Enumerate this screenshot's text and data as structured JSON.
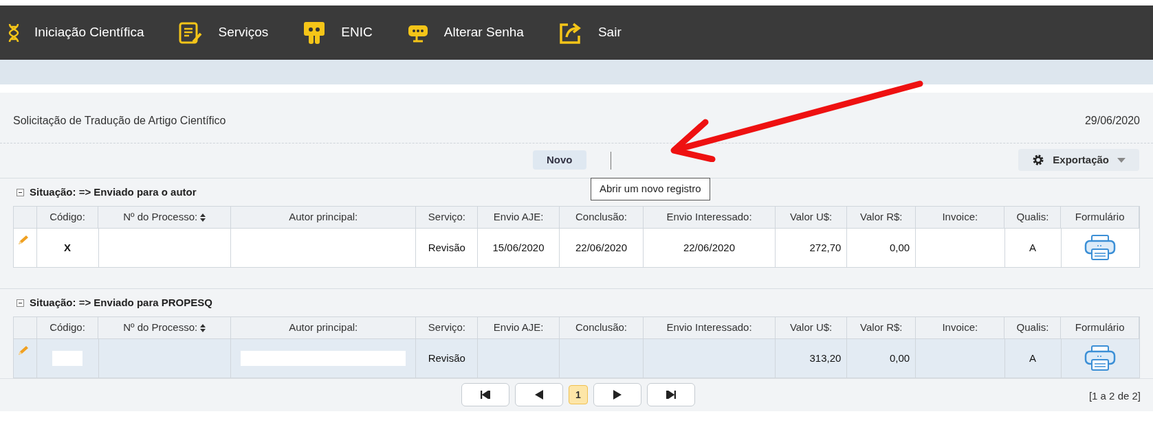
{
  "nav": [
    {
      "kind": "dna",
      "label": "Iniciação Científica"
    },
    {
      "kind": "form",
      "label": "Serviços"
    },
    {
      "kind": "badge",
      "label": "ENIC"
    },
    {
      "kind": "chat",
      "label": "Alterar Senha"
    },
    {
      "kind": "exit",
      "label": "Sair"
    }
  ],
  "page": {
    "title": "Solicitação de Tradução de Artigo Científico",
    "date": "29/06/2020"
  },
  "toolbar": {
    "new_button": "Novo",
    "tooltip": "Abrir um novo registro",
    "export_button": "Exportação"
  },
  "groups": [
    {
      "title": "Situação: => Enviado para o autor",
      "expanded": true,
      "selected": false,
      "columns": [
        "Código:",
        "Nº do Processo:",
        "Autor principal:",
        "Serviço:",
        "Envio AJE:",
        "Conclusão:",
        "Envio Interessado:",
        "Valor U$:",
        "Valor R$:",
        "Invoice:",
        "Qualis:",
        "Formulário"
      ],
      "rows": [
        {
          "codigo": "X",
          "processo": "",
          "autor": "",
          "servico": "Revisão",
          "envio_aje": "15/06/2020",
          "conclusao": "22/06/2020",
          "envio_interessado": "22/06/2020",
          "valor_usd": "272,70",
          "valor_brl": "0,00",
          "invoice": "",
          "qualis": "A",
          "redacted": false
        }
      ]
    },
    {
      "title": "Situação: => Enviado para PROPESQ",
      "expanded": true,
      "selected": true,
      "columns": [
        "Código:",
        "Nº do Processo:",
        "Autor principal:",
        "Serviço:",
        "Envio AJE:",
        "Conclusão:",
        "Envio Interessado:",
        "Valor U$:",
        "Valor R$:",
        "Invoice:",
        "Qualis:",
        "Formulário"
      ],
      "rows": [
        {
          "codigo": "",
          "processo": "",
          "autor": "",
          "servico": "Revisão",
          "envio_aje": "",
          "conclusao": "",
          "envio_interessado": "",
          "valor_usd": "313,20",
          "valor_brl": "0,00",
          "invoice": "",
          "qualis": "A",
          "redacted": true
        }
      ]
    }
  ],
  "pagination": {
    "pages": [
      {
        "label": "1",
        "selected": true
      }
    ],
    "summary": "[1 a 2 de 2]"
  }
}
